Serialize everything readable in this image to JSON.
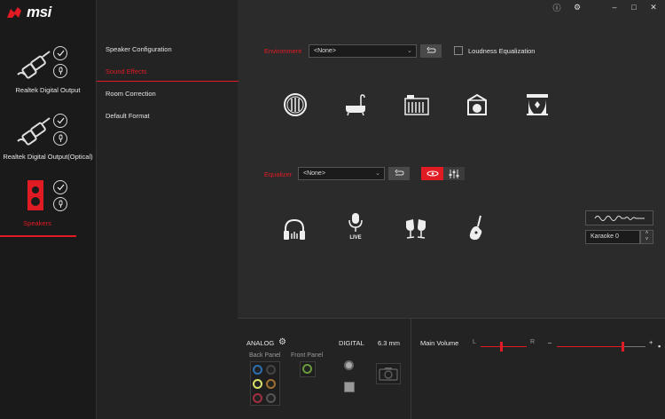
{
  "app": {
    "logo_text": "msi"
  },
  "titlebar": {
    "info": "ⓘ",
    "settings": "⚙",
    "minimize": "–",
    "maximize": "□",
    "close": "✕"
  },
  "devices": [
    {
      "name": "Realtek Digital Output"
    },
    {
      "name": "Realtek Digital Output(Optical)"
    },
    {
      "name": "Speakers"
    }
  ],
  "menu": {
    "items": [
      {
        "label": "Speaker Configuration"
      },
      {
        "label": "Sound Effects"
      },
      {
        "label": "Room Correction"
      },
      {
        "label": "Default Format"
      }
    ]
  },
  "environment": {
    "label": "Environment",
    "selected": "<None>",
    "loudness_label": "Loudness Equalization",
    "loudness_checked": false,
    "icons": [
      "generic-room-icon",
      "bathroom-icon",
      "living-room-icon",
      "stone-room-icon",
      "theater-icon"
    ]
  },
  "equalizer": {
    "label": "Equalizer",
    "selected": "<None>",
    "icons": [
      "headphones-icon",
      "live-microphone-icon",
      "toast-icon",
      "guitar-icon"
    ]
  },
  "karaoke": {
    "value": "Karaoke 0"
  },
  "bottom": {
    "analog_label": "ANALOG",
    "back_panel": "Back Panel",
    "front_panel": "Front Panel",
    "digital_label": "DIGITAL",
    "jack_size": "6.3 mm",
    "main_volume_label": "Main Volume",
    "balance_left": "L",
    "balance_right": "R",
    "vol_minus": "–",
    "vol_plus": "+",
    "balance_level": 0.45,
    "volume_level": 0.74
  },
  "colors": {
    "accent": "#e01b24",
    "bg": "#2b2b2b",
    "sidebar": "#1a1a1a"
  }
}
